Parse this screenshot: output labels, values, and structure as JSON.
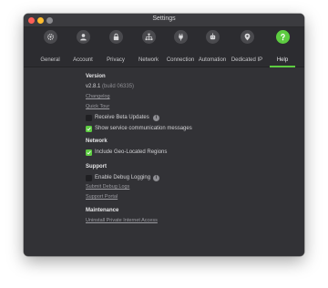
{
  "window": {
    "title": "Settings"
  },
  "colors": {
    "accent": "#5dcc41",
    "background": "#323236",
    "toolbar": "#2c2c30"
  },
  "tabs": [
    {
      "label": "General",
      "icon": "gear-icon"
    },
    {
      "label": "Account",
      "icon": "user-icon"
    },
    {
      "label": "Privacy",
      "icon": "lock-icon"
    },
    {
      "label": "Network",
      "icon": "network-icon"
    },
    {
      "label": "Connection",
      "icon": "plug-icon"
    },
    {
      "label": "Automation",
      "icon": "automation-icon"
    },
    {
      "label": "Dedicated IP",
      "icon": "dedicated-ip-icon"
    },
    {
      "label": "Help",
      "icon": "help-icon",
      "active": true
    }
  ],
  "version": {
    "heading": "Version",
    "number": "v2.8.1",
    "build": "(build 06335)",
    "changelog_link": "Changelog",
    "quicktour_link": "Quick Tour",
    "beta_label": "Receive Beta Updates",
    "beta_checked": false,
    "service_msgs_label": "Show service communication messages",
    "service_msgs_checked": true
  },
  "network": {
    "heading": "Network",
    "geo_label": "Include Geo-Located Regions",
    "geo_checked": true
  },
  "support": {
    "heading": "Support",
    "debug_label": "Enable Debug Logging",
    "debug_checked": false,
    "submit_logs_link": "Submit Debug Logs",
    "portal_link": "Support Portal"
  },
  "maintenance": {
    "heading": "Maintenance",
    "uninstall_link": "Uninstall Private Internet Access"
  }
}
